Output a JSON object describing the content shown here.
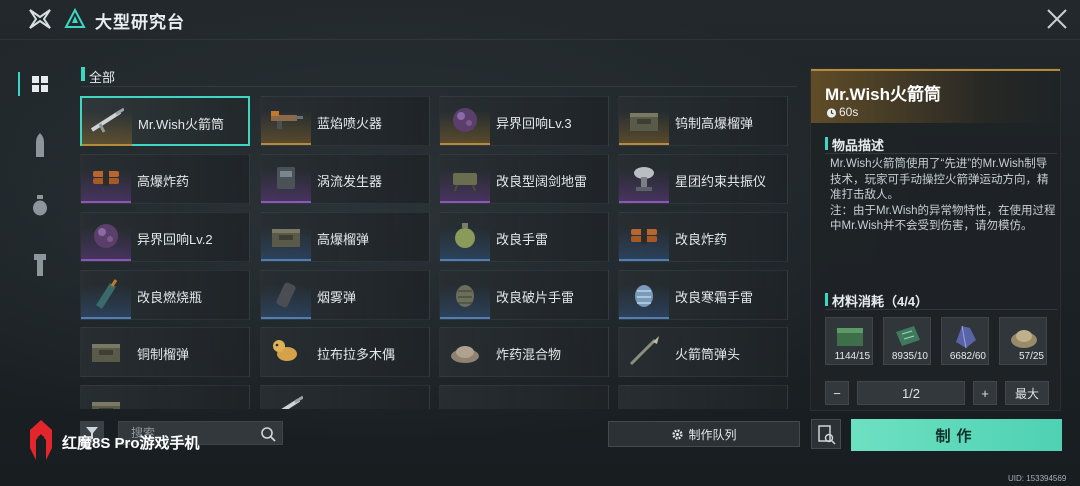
{
  "header": {
    "title": "大型研究台"
  },
  "category": {
    "label": "全部"
  },
  "nav": [
    "grid-icon",
    "bullet-icon",
    "grenade-icon",
    "tool-icon"
  ],
  "items": [
    {
      "name": "Mr.Wish火箭筒",
      "quality": "gold",
      "icon": "rocket-launcher-icon",
      "selected": true
    },
    {
      "name": "蓝焰喷火器",
      "quality": "gold",
      "icon": "flamethrower-icon"
    },
    {
      "name": "异界回响Lv.3",
      "quality": "gold",
      "icon": "echo-orb-icon"
    },
    {
      "name": "钨制高爆榴弹",
      "quality": "gold",
      "icon": "ammo-crate-icon"
    },
    {
      "name": "高爆炸药",
      "quality": "purple",
      "icon": "explosive-pack-icon"
    },
    {
      "name": "涡流发生器",
      "quality": "purple",
      "icon": "vortex-device-icon"
    },
    {
      "name": "改良型阔剑地雷",
      "quality": "purple",
      "icon": "claymore-icon"
    },
    {
      "name": "星团约束共振仪",
      "quality": "purple",
      "icon": "dish-device-icon"
    },
    {
      "name": "异界回响Lv.2",
      "quality": "purple",
      "icon": "echo-orb-icon"
    },
    {
      "name": "高爆榴弹",
      "quality": "blue",
      "icon": "ammo-crate-icon"
    },
    {
      "name": "改良手雷",
      "quality": "blue",
      "icon": "grenade-icon"
    },
    {
      "name": "改良炸药",
      "quality": "blue",
      "icon": "explosive-pack-icon"
    },
    {
      "name": "改良燃烧瓶",
      "quality": "blue",
      "icon": "molotov-icon"
    },
    {
      "name": "烟雾弹",
      "quality": "blue",
      "icon": "smoke-grenade-icon"
    },
    {
      "name": "改良破片手雷",
      "quality": "blue",
      "icon": "frag-grenade-icon"
    },
    {
      "name": "改良寒霜手雷",
      "quality": "blue",
      "icon": "frost-grenade-icon"
    },
    {
      "name": "铜制榴弹",
      "quality": "none",
      "icon": "ammo-crate-icon"
    },
    {
      "name": "拉布拉多木偶",
      "quality": "none",
      "icon": "dog-toy-icon"
    },
    {
      "name": "炸药混合物",
      "quality": "none",
      "icon": "powder-pile-icon"
    },
    {
      "name": "火箭筒弹头",
      "quality": "none",
      "icon": "rocket-warhead-icon"
    },
    {
      "name": "",
      "quality": "none",
      "icon": "ammo-crate-icon"
    },
    {
      "name": "",
      "quality": "none",
      "icon": "rocket-launcher-icon"
    },
    {
      "name": "",
      "quality": "none",
      "icon": ""
    },
    {
      "name": "",
      "quality": "none",
      "icon": ""
    }
  ],
  "search": {
    "placeholder": "搜索"
  },
  "queue": {
    "label": "制作队列"
  },
  "detail": {
    "title": "Mr.Wish火箭筒",
    "time": "60s",
    "desc_heading": "物品描述",
    "description": "Mr.Wish火箭筒使用了“先进”的Mr.Wish制导技术，玩家可手动操控火箭弹运动方向，精准打击敌人。\n注：由于Mr.Wish的异常物特性，在使用过程中Mr.Wish并不会受到伤害，请勿模仿。",
    "materials_heading": "材料消耗（4/4）",
    "materials": [
      {
        "count": "1144/15",
        "icon": "green-crate-icon"
      },
      {
        "count": "8935/10",
        "icon": "circuit-board-icon"
      },
      {
        "count": "6682/60",
        "icon": "crystal-icon"
      },
      {
        "count": "57/25",
        "icon": "ore-pile-icon"
      }
    ],
    "quantity": "1/2",
    "minus": "−",
    "plus": "+",
    "max_label": "最大",
    "craft_label": "制作"
  },
  "brand": {
    "text": "红魔8S Pro游戏手机"
  },
  "uid": "UID: 153394569",
  "colors": {
    "accent": "#3ad8c3",
    "gold": "#b58a3a",
    "purple": "#8a56b8",
    "blue": "#4f7fb4",
    "craft": "#5ed8bb"
  }
}
